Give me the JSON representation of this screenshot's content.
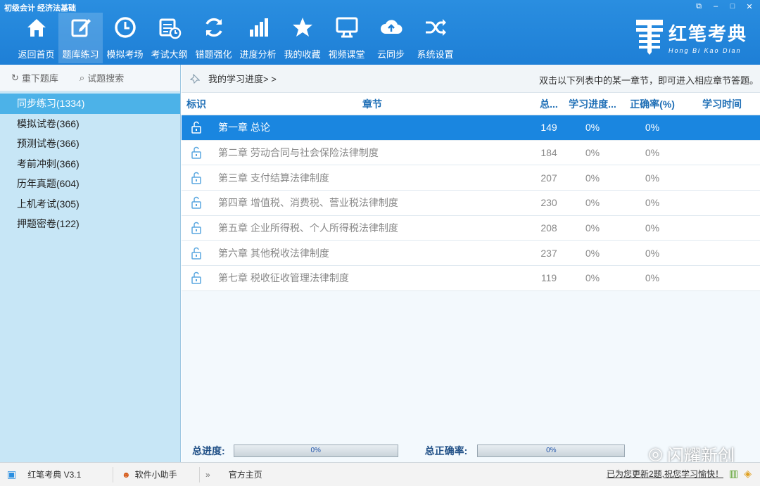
{
  "window": {
    "title": "初级会计 经济法基础",
    "controls": [
      "restore-icon",
      "minimize-icon",
      "maximize-icon",
      "close-icon"
    ]
  },
  "toolbar": {
    "items": [
      {
        "label": "返回首页",
        "icon": "home-icon"
      },
      {
        "label": "题库练习",
        "icon": "edit-icon",
        "active": true
      },
      {
        "label": "模拟考场",
        "icon": "clock-icon"
      },
      {
        "label": "考试大纲",
        "icon": "calendar-icon"
      },
      {
        "label": "错题强化",
        "icon": "refresh-icon"
      },
      {
        "label": "进度分析",
        "icon": "bar-chart-icon"
      },
      {
        "label": "我的收藏",
        "icon": "star-icon"
      },
      {
        "label": "视频课堂",
        "icon": "monitor-icon"
      },
      {
        "label": "云同步",
        "icon": "cloud-icon"
      },
      {
        "label": "系统设置",
        "icon": "shuffle-icon"
      }
    ]
  },
  "brand": {
    "name": "红笔考典",
    "subtitle": "Hong Bi Kao Dian"
  },
  "sidebar": {
    "reload_label": "重下题库",
    "search_label": "试题搜索",
    "items": [
      {
        "label": "同步练习(1334)",
        "active": true
      },
      {
        "label": "模拟试卷(366)"
      },
      {
        "label": "预测试卷(366)"
      },
      {
        "label": "考前冲刺(366)"
      },
      {
        "label": "历年真题(604)"
      },
      {
        "label": "上机考试(305)"
      },
      {
        "label": "押题密卷(122)"
      }
    ]
  },
  "main": {
    "breadcrumb": "我的学习进度> >",
    "hint": "双击以下列表中的某一章节，即可进入相应章节答题。",
    "columns": [
      "标识",
      "章节",
      "总...",
      "学习进度...",
      "正确率(%)",
      "学习时间"
    ],
    "rows": [
      {
        "chapter": "第一章 总论",
        "total": "149",
        "progress": "0%",
        "accuracy": "0%",
        "time": "",
        "selected": true
      },
      {
        "chapter": "第二章 劳动合同与社会保险法律制度",
        "total": "184",
        "progress": "0%",
        "accuracy": "0%",
        "time": ""
      },
      {
        "chapter": "第三章 支付结算法律制度",
        "total": "207",
        "progress": "0%",
        "accuracy": "0%",
        "time": ""
      },
      {
        "chapter": "第四章 增值税、消费税、营业税法律制度",
        "total": "230",
        "progress": "0%",
        "accuracy": "0%",
        "time": ""
      },
      {
        "chapter": "第五章 企业所得税、个人所得税法律制度",
        "total": "208",
        "progress": "0%",
        "accuracy": "0%",
        "time": ""
      },
      {
        "chapter": "第六章 其他税收法律制度",
        "total": "237",
        "progress": "0%",
        "accuracy": "0%",
        "time": ""
      },
      {
        "chapter": "第七章 税收征收管理法律制度",
        "total": "119",
        "progress": "0%",
        "accuracy": "0%",
        "time": ""
      }
    ],
    "total_progress_label": "总进度:",
    "total_progress_value": "0%",
    "total_accuracy_label": "总正确率:",
    "total_accuracy_value": "0%"
  },
  "watermark": "闪耀新创",
  "statusbar": {
    "app_version": "红笔考典 V3.1",
    "assistant": "软件小助手",
    "homepage": "官方主页",
    "update_msg": "已为您更新2题,祝您学习愉快！"
  },
  "colors": {
    "toolbar_bg": "#1e7fd6",
    "sidebar_bg": "#c7e6f6",
    "sidebar_active": "#4cb2e8",
    "row_selected": "#1a86e0",
    "header_text": "#1f6fb6"
  }
}
